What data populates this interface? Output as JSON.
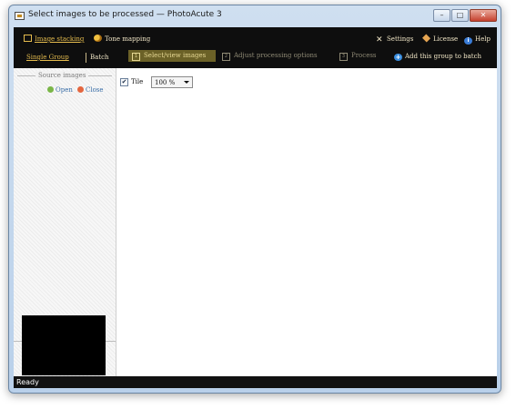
{
  "window": {
    "title": "Select images to be processed — PhotoAcute 3",
    "controls": {
      "minimize": "–",
      "maximize": "□",
      "close": "✕"
    }
  },
  "modes": [
    {
      "label": "Image stacking",
      "icon": "image-stack-icon"
    },
    {
      "label": "Tone mapping",
      "icon": "tone-mapping-icon"
    }
  ],
  "top_links": [
    {
      "label": "Settings",
      "icon": "settings-icon"
    },
    {
      "label": "License",
      "icon": "license-icon"
    },
    {
      "label": "Help",
      "icon": "help-icon"
    }
  ],
  "group_tabs": [
    {
      "label": "Single Group"
    },
    {
      "label": "Batch"
    }
  ],
  "steps": [
    {
      "num": "1",
      "label": "Select/view images",
      "active": true
    },
    {
      "num": "2",
      "label": "Adjust processing options",
      "active": false
    },
    {
      "num": "3",
      "label": "Process",
      "active": false
    }
  ],
  "add_batch": {
    "label": "Add this group to batch",
    "icon": "add-batch-icon"
  },
  "source_images": {
    "title": "Source images",
    "open_label": "Open",
    "close_label": "Close"
  },
  "view_options": {
    "tile_label": "Tile",
    "tile_checked": true,
    "zoom_value": "100 %"
  },
  "status": {
    "text": "Ready"
  }
}
